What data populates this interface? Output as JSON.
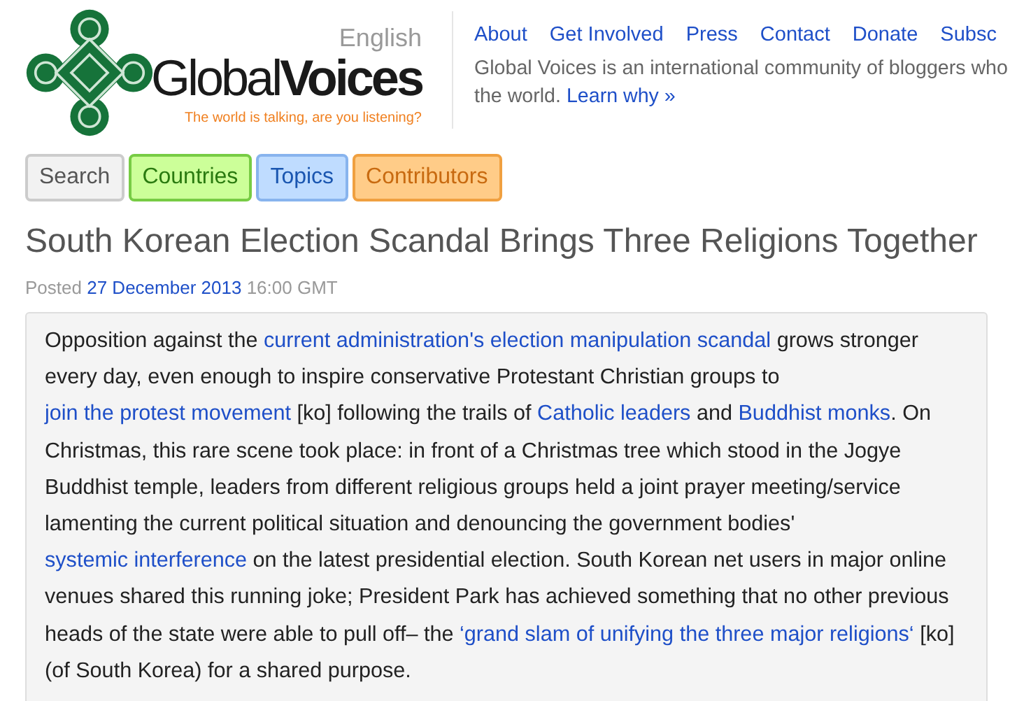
{
  "header": {
    "language": "English",
    "logo_text": "Global**Voices**",
    "tagline": "The world is talking, are you listening?",
    "nav_links": [
      "About",
      "Get Involved",
      "Press",
      "Contact",
      "Donate",
      "Subsc"
    ],
    "description_lines": [
      [
        {
          "text": "Global Voices is an international community of bloggers who",
          "link": false
        }
      ],
      [
        {
          "text": "the world.",
          "link": false
        },
        {
          "text": "Learn why »",
          "link": true
        }
      ]
    ]
  },
  "menu": [
    {
      "label": "Search",
      "kind": "search",
      "color": "#f2f2f2"
    },
    {
      "label": "Countries",
      "kind": "countries",
      "color": "#ccff99"
    },
    {
      "label": "Topics",
      "kind": "topics",
      "color": "#bfdcff"
    },
    {
      "label": "Contributors",
      "kind": "contributors",
      "color": "#ffcc88"
    }
  ],
  "article": {
    "title": "South Korean Election Scandal Brings Three Religions Together",
    "posted": [
      {
        "text": "Posted",
        "link": false
      },
      {
        "text": "27 December 2013",
        "link": true
      },
      {
        "text": "16:00 GMT",
        "link": false
      }
    ],
    "paragraph": [
      {
        "text": "Opposition against the ",
        "link": false
      },
      {
        "text": "current administration's election manipulation scandal",
        "link": true
      },
      {
        "text": " grows stronger every day, even enough to inspire conservative Protestant Christian groups to ",
        "link": false
      },
      {
        "text": "join the protest movement",
        "link": true
      },
      {
        "text": " [ko] following the trails of ",
        "link": false
      },
      {
        "text": "Catholic leaders",
        "link": true
      },
      {
        "text": " and ",
        "link": false
      },
      {
        "text": "Buddhist monks",
        "link": true
      },
      {
        "text": ". On Christmas, this rare scene took place: in front of a Christmas tree which stood in the Jogye Buddhist temple, leaders from different religious groups held a joint prayer meeting/service lamenting the current political situation and denouncing the government bodies' ",
        "link": false
      },
      {
        "text": "systemic interference",
        "link": true
      },
      {
        "text": " on the latest presidential election. South Korean net users in major online venues shared this running joke; President Park has achieved something that no other previous heads of the state were able to pull off– the ",
        "link": false
      },
      {
        "text": "‘grand slam of unifying the three major religions‘",
        "link": true
      },
      {
        "text": " [ko] (of South Korea) for a shared purpose.",
        "link": false
      }
    ]
  }
}
